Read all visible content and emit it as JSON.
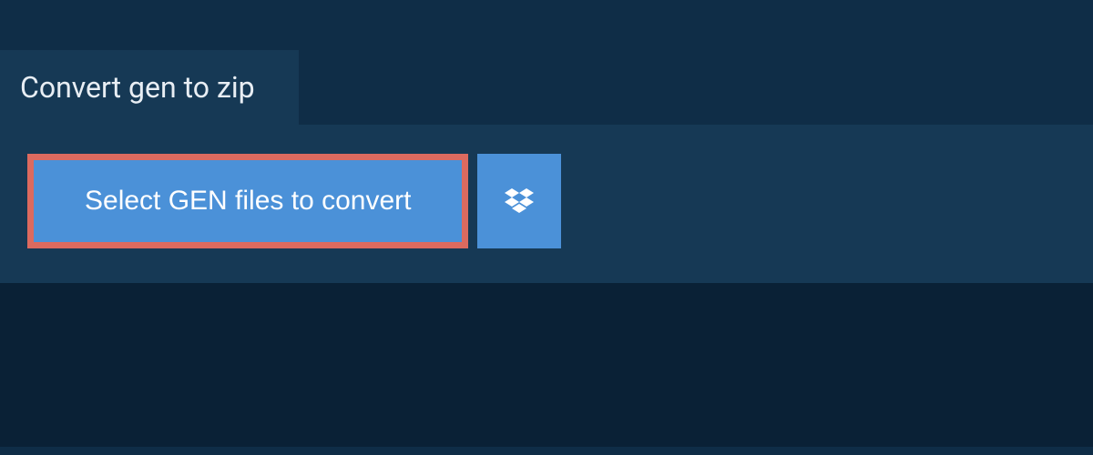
{
  "tab": {
    "title": "Convert gen to zip"
  },
  "actions": {
    "select_files_label": "Select GEN files to convert"
  },
  "colors": {
    "page_bg": "#0f2d47",
    "panel_bg": "#163955",
    "button_bg": "#4b91d8",
    "highlight_border": "#dc6a5f",
    "text_light": "#e8eef4"
  }
}
